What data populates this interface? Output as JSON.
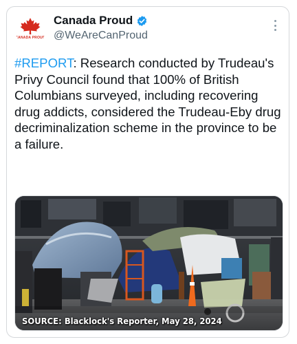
{
  "colors": {
    "brand_red": "#d52b1e",
    "verified_blue": "#1d9bf0",
    "text_primary": "#0f1419",
    "text_secondary": "#536471"
  },
  "tweet": {
    "author": {
      "name": "Canada Proud",
      "handle": "@WeAreCanProud",
      "avatar_text": "CANADA PROUD",
      "avatar_icon": "maple-leaf-icon",
      "verified": true
    },
    "more_icon": "more-options-icon",
    "hashtag": "#REPORT",
    "body": ": Research conducted by Trudeau's Privy Council found that 100% of British Columbians surveyed, including recovering drug addicts, considered the Trudeau-Eby drug decriminalization scheme in the province to be a failure.",
    "media": {
      "caption": "SOURCE: Blacklock's Reporter, May 28, 2024"
    }
  }
}
